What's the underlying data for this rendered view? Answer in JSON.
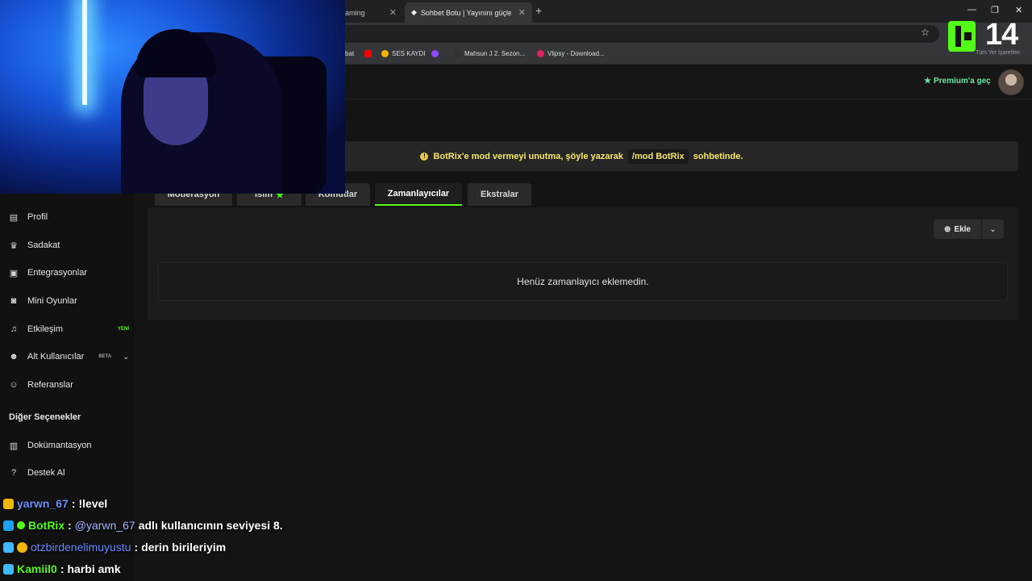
{
  "browser": {
    "tabs": [
      {
        "title": "aming"
      },
      {
        "title": "Sohbet Botu | Yayınını güçlendir"
      }
    ],
    "bookmarks": [
      "bat",
      "SES KAYDI",
      "Mahsun J 2. Sezon...",
      "Vlipsy - Download..."
    ],
    "bookmarks_right": "Tüm Yer İşaretleri"
  },
  "overlay": {
    "logo_number": "14"
  },
  "header": {
    "premium_label": "Premium'a geç"
  },
  "banner": {
    "prefix": "BotRix'e mod vermeyi unutma, şöyle yazarak",
    "command": "/mod BotRix",
    "suffix": "sohbetinde."
  },
  "tabs": [
    {
      "label": "Moderasyon"
    },
    {
      "label": "İsim"
    },
    {
      "label": "Komutlar"
    },
    {
      "label": "Zamanlayıcılar"
    },
    {
      "label": "Ekstralar"
    }
  ],
  "panel": {
    "add_label": "Ekle",
    "empty_text": "Henüz zamanlayıcı eklemedin."
  },
  "sidebar": {
    "items": [
      {
        "label": "Profil",
        "icon": "id-card-icon"
      },
      {
        "label": "Sadakat",
        "icon": "trophy-icon"
      },
      {
        "label": "Entegrasyonlar",
        "icon": "plug-icon"
      },
      {
        "label": "Mini Oyunlar",
        "icon": "gamepad-icon"
      },
      {
        "label": "Etkileşim",
        "icon": "music-icon",
        "badge": "YENİ"
      },
      {
        "label": "Alt Kullanıcılar",
        "icon": "users-icon",
        "badge": "BETA"
      },
      {
        "label": "Referanslar",
        "icon": "user-friends-icon"
      }
    ],
    "section_title": "Diğer Seçenekler",
    "other_items": [
      {
        "label": "Dokümantasyon",
        "icon": "book-icon"
      },
      {
        "label": "Destek Al",
        "icon": "question-icon"
      }
    ]
  },
  "chat": [
    {
      "user": "yarwn_67",
      "user_color": "#6b8cff",
      "message": "!level"
    },
    {
      "user": "BotRix",
      "user_color": "#53fc18",
      "mention": "@yarwn_67",
      "message": "adlı kullanıcının seviyesi 8."
    },
    {
      "user": "otzbirdenelimuyustu",
      "user_color": "#6b8cff",
      "message": "derin birileriyim"
    },
    {
      "user": "Kamiil0",
      "user_color": "#53fc18",
      "message": "harbi amk"
    }
  ],
  "colors": {
    "accent": "#53fc18",
    "banner_text": "#f5e86b"
  }
}
